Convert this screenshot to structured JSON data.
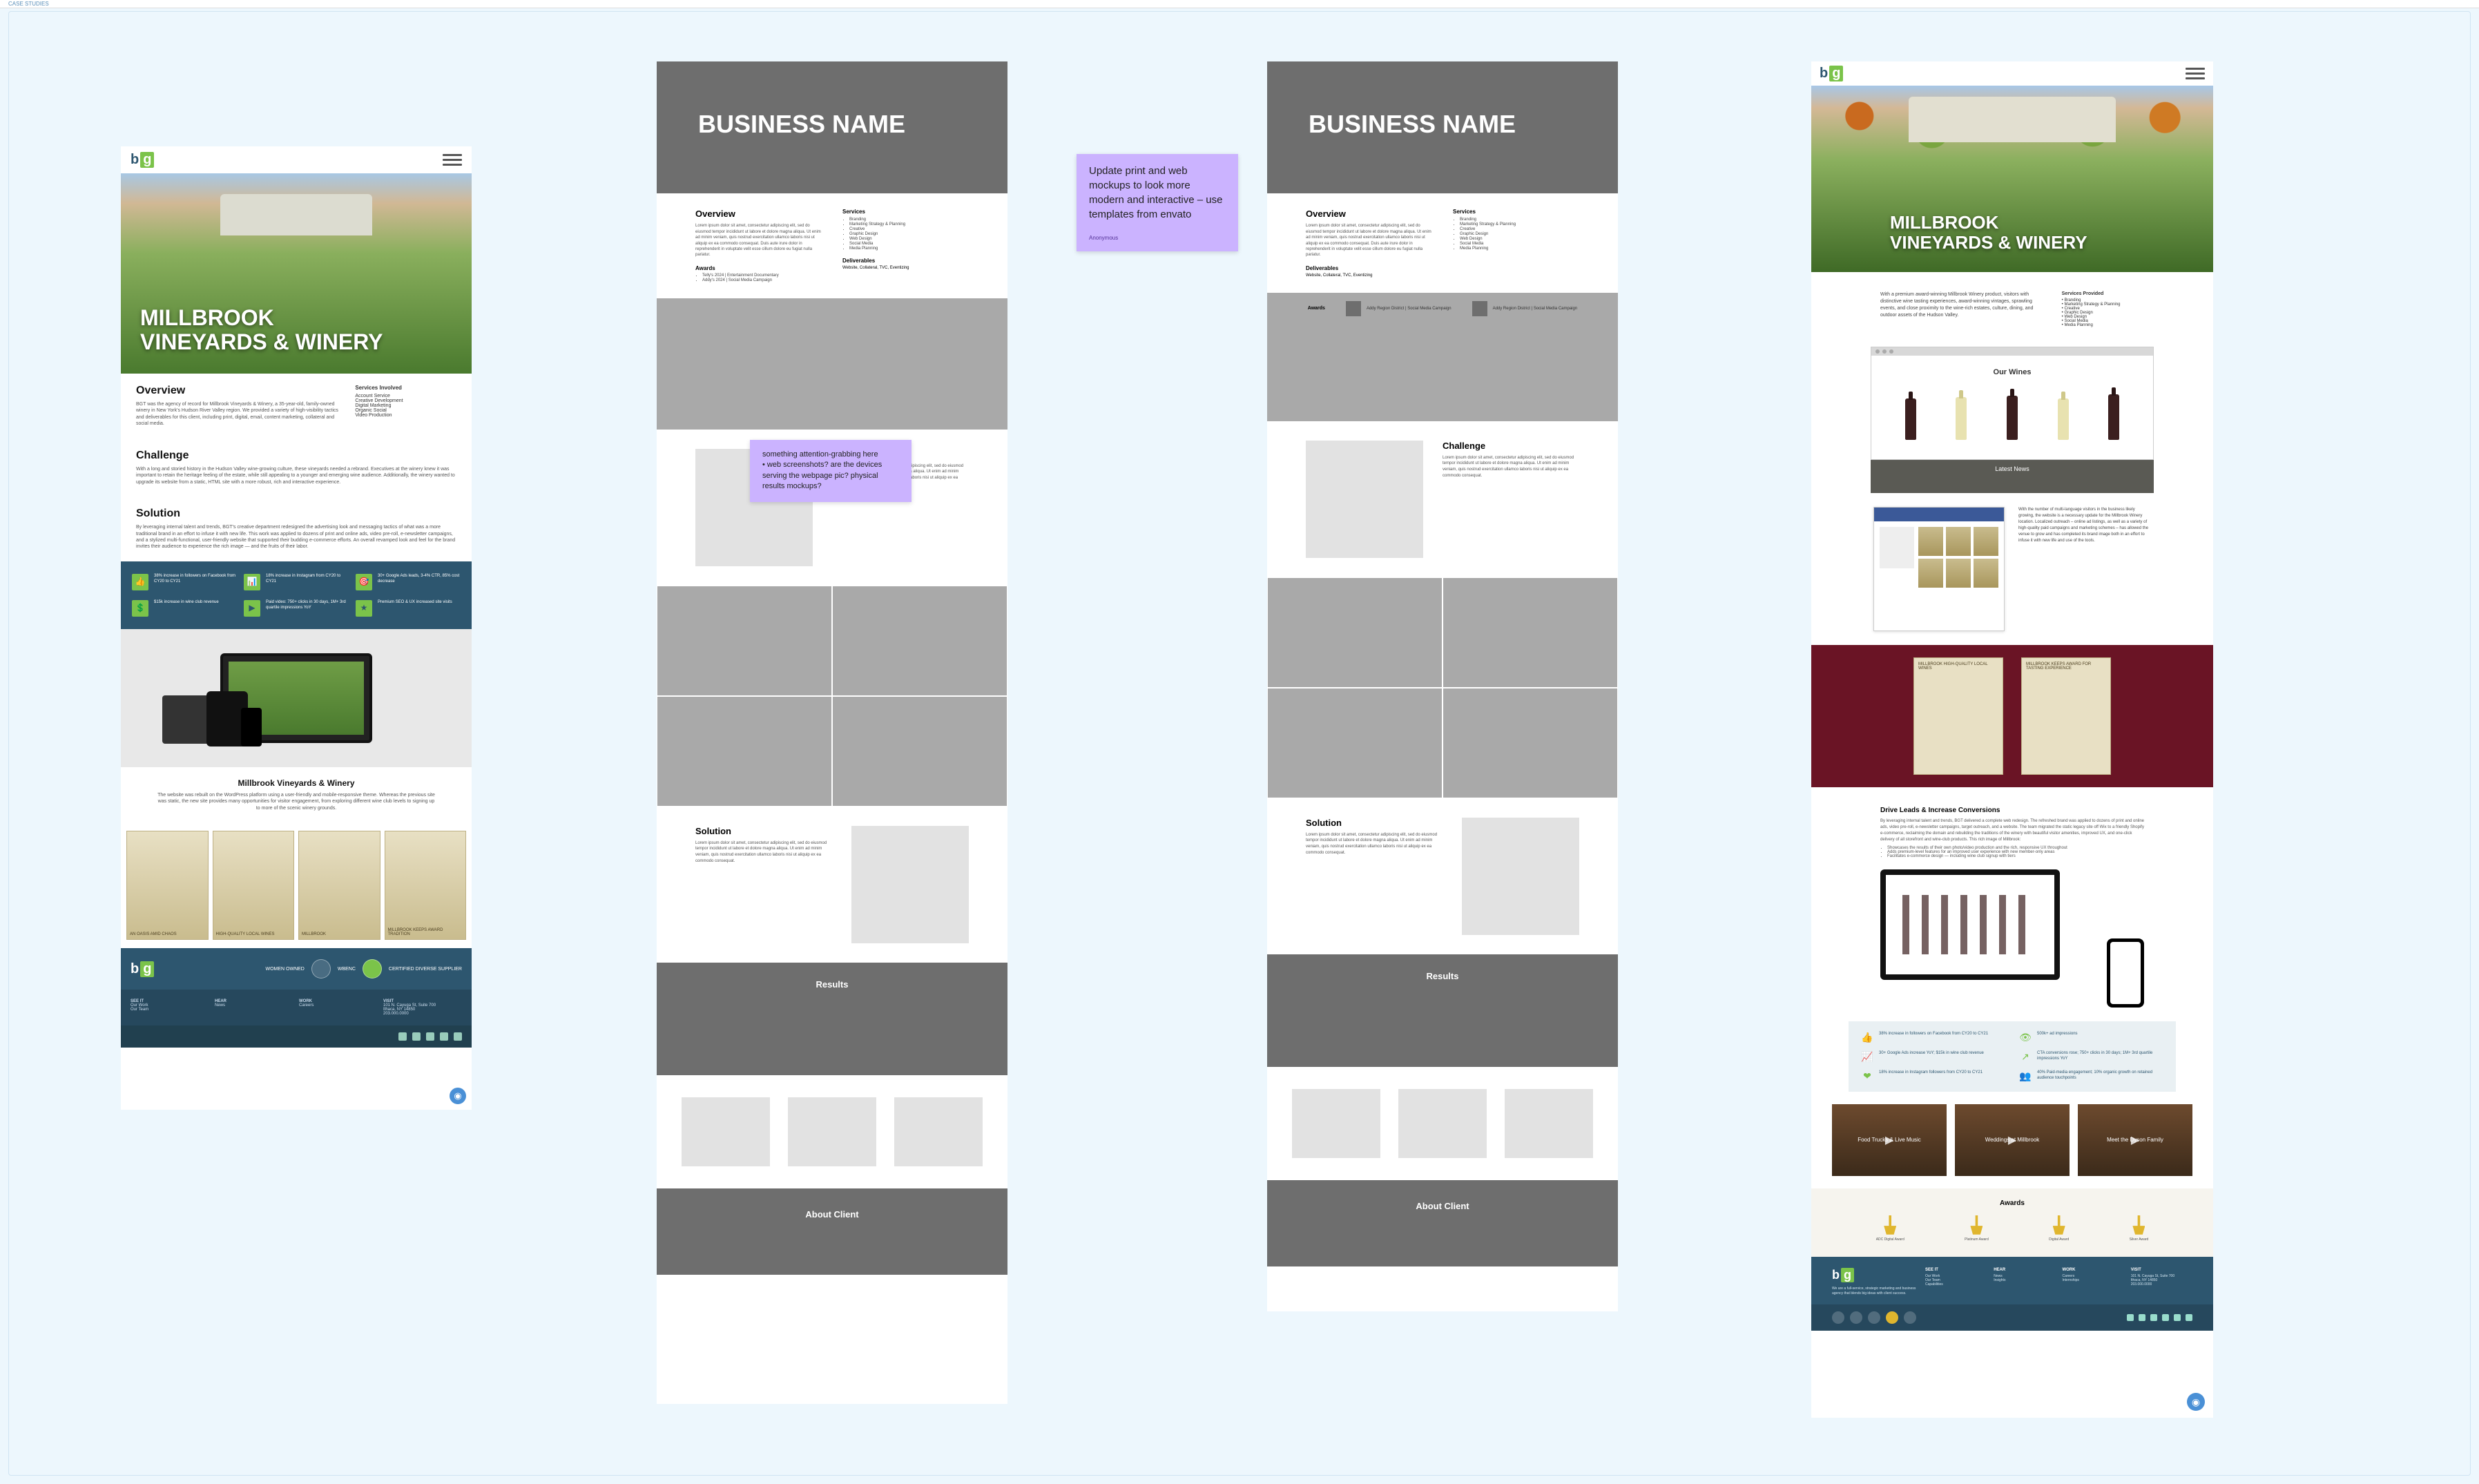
{
  "topBar": "CASE STUDIES",
  "hero": {
    "title": "MILLBROOK\nVINEYARDS & WINERY"
  },
  "frameA": {
    "overview": {
      "title": "Overview",
      "body": "BGT was the agency of record for Millbrook Vineyards & Winery, a 35-year-old, family-owned winery in New York's Hudson River Valley region. We provided a variety of high-visibility tactics and deliverables for this client, including print, digital, email, content marketing, collateral and social media.",
      "servicesTitle": "Services Involved",
      "services": [
        "Account Service",
        "Creative Development",
        "Digital Marketing",
        "Organic Social",
        "Video Production"
      ]
    },
    "challenge": {
      "title": "Challenge",
      "body": "With a long and storied history in the Hudson Valley wine-growing culture, these vineyards needed a rebrand. Executives at the winery knew it was important to retain the heritage feeling of the estate, while still appealing to a younger and emerging wine audience. Additionally, the winery wanted to upgrade its website from a static, HTML site with a more robust, rich and interactive experience."
    },
    "solution": {
      "title": "Solution",
      "body": "By leveraging internal talent and trends, BGT's creative department redesigned the advertising look and messaging tactics of what was a more traditional brand in an effort to infuse it with new life. This work was applied to dozens of print and online ads, video pre-roll, e-newsletter campaigns, and a stylized multi-functional, user-friendly website that supported their budding e-commerce efforts. An overall revamped look and feel for the brand invites their audience to experience the rich image — and the fruits of their labor."
    },
    "metrics": [
      "38% increase in followers on Facebook from CY20 to CY21",
      "18% increase in Instagram from CY20 to CY21",
      "30+ Google Ads leads, 3-4% CTR, 85% cost decrease",
      "$15k increase in wine club revenue",
      "Paid video: 750+ clicks in 30 days, 1M+ 3rd quartile impressions YoY",
      "Premium SEO & UX increased site visits"
    ],
    "devicesCaption": "Millbrook Vineyards & Winery",
    "devicesBody": "The website was rebuilt on the WordPress platform using a user-friendly and mobile-responsive theme. Whereas the previous site was static, the new site provides many opportunities for visitor engagement, from exploring different wine club levels to signing up to more of the scenic winery grounds.",
    "cards": [
      "AN OASIS AMID CHAOS",
      "HIGH-QUALITY LOCAL WINES",
      "MILLBROOK",
      "MILLBROOK KEEPS AWARD TRADITION"
    ],
    "footer": {
      "badges": [
        "WOMEN OWNED",
        "WBENC",
        "CERTIFIED DIVERSE SUPPLIER"
      ],
      "cols": [
        {
          "h": "SEE IT",
          "items": [
            "Our Work",
            "Our Team"
          ]
        },
        {
          "h": "HEAR",
          "items": [
            "News"
          ]
        },
        {
          "h": "WORK",
          "items": [
            "Careers"
          ]
        },
        {
          "h": "VISIT",
          "items": [
            "101 N. Cayuga St, Suite 700",
            "Ithaca, NY 14850",
            "203.000.0000"
          ]
        }
      ]
    }
  },
  "wireframe": {
    "heroTitle": "BUSINESS NAME",
    "overview": {
      "title": "Overview",
      "body": "Lorem ipsum dolor sit amet, consectetur adipiscing elit, sed do eiusmod tempor incididunt ut labore et dolore magna aliqua. Ut enim ad minim veniam, quis nostrud exercitation ullamco laboris nisi ut aliquip ex ea commodo consequat. Duis aute irure dolor in reprehenderit in voluptate velit esse cillum dolore eu fugiat nulla pariatur.",
      "servicesTitle": "Services",
      "services": [
        "Branding",
        "Marketing Strategy & Planning",
        "Creative",
        "Graphic Design",
        "Web Design",
        "Social Media",
        "Media Planning"
      ],
      "awardsTitle": "Awards",
      "awards": [
        "Telly's 2024 | Entertainment Documentary",
        "Addy's 2024 | Social Media Campaign"
      ],
      "delivTitle": "Deliverables",
      "deliv": [
        "Website, Collateral, TVC, Eventizing"
      ]
    },
    "challenge": {
      "title": "Challenge",
      "body": "Lorem ipsum dolor sit amet, consectetur adipiscing elit, sed do eiusmod tempor incididunt ut labore et dolore magna aliqua. Ut enim ad minim veniam, quis nostrud exercitation ullamco laboris nisi ut aliquip ex ea commodo consequat."
    },
    "solution": {
      "title": "Solution",
      "body": "Lorem ipsum dolor sit amet, consectetur adipiscing elit, sed do eiusmod tempor incididunt ut labore et dolore magna aliqua. Ut enim ad minim veniam, quis nostrud exercitation ullamco laboris nisi ut aliquip ex ea commodo consequat."
    },
    "resultsTitle": "Results",
    "aboutTitle": "About Client"
  },
  "frameC": {
    "delivTitle": "Deliverables",
    "delivBody": "Website, Collateral, TVC, Eventizing",
    "awardsBand": [
      "Addy Region District | Social Media Campaign",
      "Addy Region District | Social Media Campaign"
    ],
    "awardsHead": "Awards"
  },
  "notes": {
    "n1": "Update print and web mockups to look more modern and interactive – use templates from envato",
    "n1author": "Anonymous",
    "n2": "something attention-grabbing here\n• web screenshots? are the devices serving the webpage pic? physical results mockups?"
  },
  "frameD": {
    "intro": {
      "body": "With a premium award-winning Millbrook Winery product, visitors with distinctive wine tasting experiences, award-winning vintages, sprawling events, and close proximity to the wine-rich estates, culture, dining, and outdoor assets of the Hudson Valley.",
      "servicesTitle": "Services Provided",
      "services": [
        "Branding",
        "Marketing Strategy & Planning",
        "Creative",
        "Graphic Design",
        "Web Design",
        "Social Media",
        "Media Planning"
      ]
    },
    "ourWines": "Our Wines",
    "latestNews": "Latest News",
    "fbText": "With the number of multi-language visitors in the business likely growing, the website is a necessary update for the Millbrook Winery location. Localized outreach – online ad listings, as well as a variety of high-quality paid campaigns and marketing schemes – has allowed the venue to grow and has completed its brand image both in an effort to infuse it with new life and use of the tools.",
    "posters": [
      "MILLBROOK HIGH-QUALITY LOCAL WINES",
      "MILLBROOK KEEPS AWARD FOR TASTING EXPERIENCE"
    ],
    "drive": {
      "title": "Drive Leads & Increase Conversions",
      "body": "By leveraging internal talent and trends, BGT delivered a complete web redesign. The refreshed brand was applied to dozens of print and online ads, video pre-roll, e-newsletter campaigns, target outreach, and a website. The team migrated the static legacy site off Wix to a friendly Shopify e-commerce, reclaiming the domain and rebuilding the traditions of the winery with beautiful visitor amenities, improved UX, and one-click delivery of all storefront and wine-club products. This rich image of Millbrook:",
      "bullets": [
        "Showcases the results of their own photo/video production and the rich, responsive UX throughout",
        "Adds premium-level features for an improved user experience with new member-only areas",
        "Facilitates e-commerce design — including wine club signup with tiers"
      ]
    },
    "stats": [
      "38% increase in followers on Facebook from CY20 to CY21",
      "500k+ ad impressions",
      "30+ Google Ads increase YoY; $15k in wine club revenue",
      "CTA conversions rose; 750+ clicks in 30 days; 1M+ 3rd quartile impressions YoY",
      "18% increase in Instagram followers from CY20 to CY21",
      "40% Paid-media engagement; 10% organic growth on retained audience touchpoints"
    ],
    "videoTitles": [
      "Food Trucks & Live Music",
      "Weddings at Millbrook",
      "Meet the Dyson Family"
    ],
    "awardsTitle": "Awards",
    "awardNames": [
      "ADC Digital Award",
      "Platinum Award",
      "Digital Award",
      "Silver Award"
    ],
    "footer": {
      "tagline": "We are a full-service, strategic marketing and business agency that blends big ideas with client success.",
      "cols": [
        {
          "h": "SEE IT",
          "items": [
            "Our Work",
            "Our Team",
            "Capabilities"
          ]
        },
        {
          "h": "HEAR",
          "items": [
            "News",
            "Insights"
          ]
        },
        {
          "h": "WORK",
          "items": [
            "Careers",
            "Internships"
          ]
        },
        {
          "h": "VISIT",
          "items": [
            "101 N. Cayuga St, Suite 700",
            "Ithaca, NY 14850",
            "203.000.0000"
          ]
        }
      ]
    }
  }
}
